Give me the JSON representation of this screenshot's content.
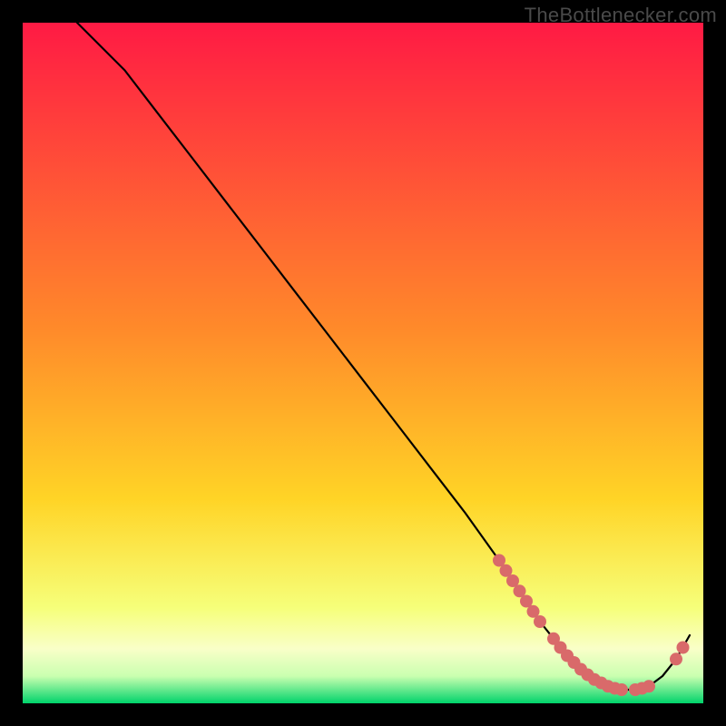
{
  "watermark": "TheBottlenecker.com",
  "chart_data": {
    "type": "line",
    "title": "",
    "xlabel": "",
    "ylabel": "",
    "xlim": [
      0,
      100
    ],
    "ylim": [
      0,
      100
    ],
    "grid": false,
    "legend": false,
    "background_gradient": {
      "top_color": "#ff1a44",
      "mid_color": "#ffd426",
      "bottom_band_color": "#f9ffc8",
      "base_color": "#00d36b"
    },
    "series": [
      {
        "name": "bottleneck-curve",
        "color": "#000000",
        "x": [
          8,
          10,
          12,
          15,
          20,
          25,
          30,
          35,
          40,
          45,
          50,
          55,
          60,
          65,
          70,
          72,
          74,
          76,
          78,
          80,
          82,
          84,
          86,
          88,
          90,
          92,
          94,
          96,
          98
        ],
        "y": [
          100,
          98,
          96,
          93,
          86.5,
          80,
          73.5,
          67,
          60.5,
          54,
          47.5,
          41,
          34.5,
          28,
          21,
          18,
          15,
          12,
          9.5,
          7,
          5,
          3.5,
          2.5,
          2,
          2,
          2.5,
          4,
          6.5,
          10
        ]
      }
    ],
    "highlight_dots": {
      "color": "#d96a6a",
      "radius_px": 7,
      "segments": [
        {
          "x": [
            70,
            71,
            72,
            73,
            74,
            75,
            76
          ],
          "y": [
            21,
            19.5,
            18,
            16.5,
            15,
            13.5,
            12
          ]
        },
        {
          "x": [
            78,
            79,
            80,
            81,
            82,
            83,
            84,
            85,
            86,
            87,
            88
          ],
          "y": [
            9.5,
            8.2,
            7,
            6,
            5,
            4.2,
            3.5,
            3,
            2.5,
            2.2,
            2
          ]
        },
        {
          "x": [
            90,
            91,
            92
          ],
          "y": [
            2,
            2.2,
            2.5
          ]
        },
        {
          "x": [
            96,
            97
          ],
          "y": [
            6.5,
            8.2
          ]
        }
      ]
    }
  }
}
